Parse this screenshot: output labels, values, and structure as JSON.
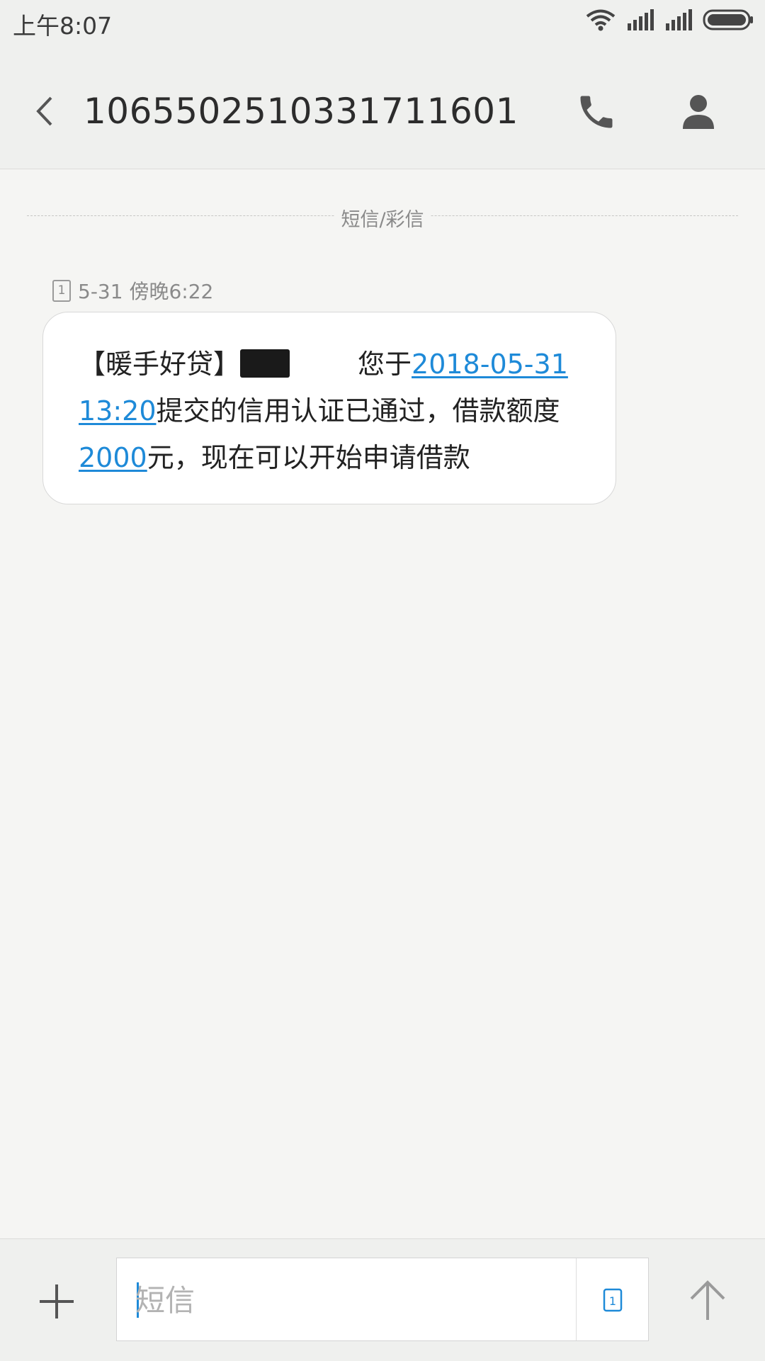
{
  "status_bar": {
    "time": "上午8:07"
  },
  "header": {
    "title": "10655025103317116​01"
  },
  "thread": {
    "divider_label": "短信/彩信",
    "message": {
      "sim": "1",
      "timestamp": "5-31 傍晚6:22",
      "sender_tag": "【暖手好贷】",
      "text_part1": "您于",
      "link_datetime": "2018-05-31 13:20",
      "text_part2": "提交的信用认证已通过，借款额度",
      "link_amount": "2000",
      "text_part3": "元，现在可以开始申请借款"
    }
  },
  "composer": {
    "plus_label": "+",
    "placeholder": "短信",
    "sim": "1"
  },
  "colors": {
    "link": "#1e8ad8",
    "bar_background": "#eff0ee",
    "page_background": "#f5f5f3"
  },
  "icons": [
    "wifi-icon",
    "signal-icon",
    "battery-icon",
    "back-arrow-icon",
    "phone-icon",
    "contact-icon",
    "plus-icon",
    "sim-card-icon",
    "send-arrow-icon"
  ]
}
